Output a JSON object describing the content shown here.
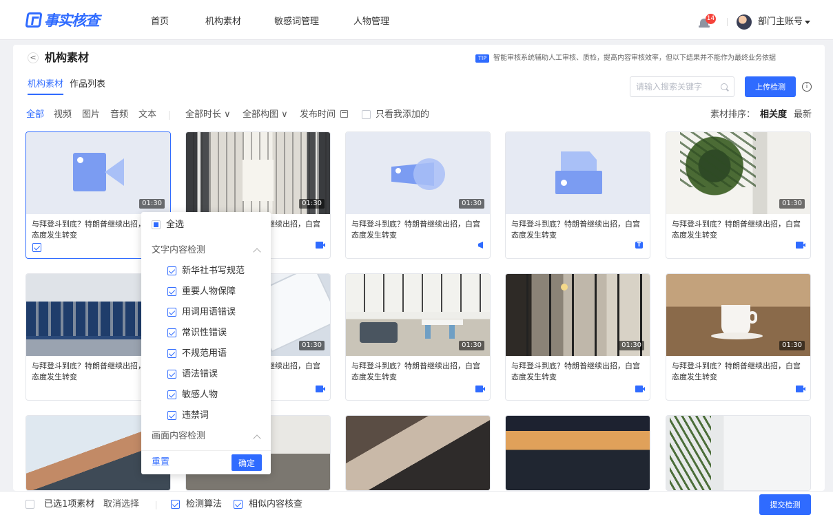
{
  "brand": {
    "logo_text": "事实核查"
  },
  "nav": {
    "items": [
      "首页",
      "机构素材",
      "敏感词管理",
      "人物管理"
    ]
  },
  "user": {
    "notification_count": "14",
    "account_label": "部门主账号"
  },
  "page": {
    "title": "机构素材",
    "tip_badge": "TIP",
    "tip_text": "智能审核系统辅助人工审核、质检，提高内容审核效率，但以下结果并不能作为最终业务依据"
  },
  "tabs": [
    "机构素材",
    "作品列表"
  ],
  "search": {
    "placeholder": "请输入搜索关键字"
  },
  "upload_label": "上传检测",
  "filters": {
    "types": [
      "全部",
      "视频",
      "图片",
      "音频",
      "文本"
    ],
    "duration": "全部时长",
    "composition": "全部构图",
    "publish_time": "发布时间",
    "mine_only": "只看我添加的",
    "sort_label": "素材排序：",
    "sort_options": [
      "相关度",
      "最新"
    ]
  },
  "cards": [
    {
      "title": "与拜登斗到底？特朗普继续出招，白宫态度发生转变",
      "duration": "01:30",
      "type_icon": "checkbox",
      "selected": true
    },
    {
      "title": "与拜登斗到底？特朗普继续出招，白宫态度发生转变",
      "duration": "01:30",
      "type_icon": "video-icon"
    },
    {
      "title": "与拜登斗到底？特朗普继续出招，白宫态度发生转变",
      "duration": "01:30",
      "type_icon": "audio-icon"
    },
    {
      "title": "与拜登斗到底？特朗普继续出招，白宫态度发生转变",
      "duration": "",
      "type_icon": "text-icon"
    },
    {
      "title": "与拜登斗到底？特朗普继续出招，白宫态度发生转变",
      "duration": "01:30",
      "type_icon": "video-icon"
    },
    {
      "title": "与拜登斗到底？特朗普继续出招，白宫态度发生转变",
      "duration": "",
      "type_icon": "video-icon"
    },
    {
      "title": "与拜登斗到底？特朗普继续出招，白宫态度发生转变",
      "duration": "01:30",
      "type_icon": "video-icon"
    },
    {
      "title": "与拜登斗到底？特朗普继续出招，白宫态度发生转变",
      "duration": "01:30",
      "type_icon": "video-icon"
    },
    {
      "title": "与拜登斗到底？特朗普继续出招，白宫态度发生转变",
      "duration": "01:30",
      "type_icon": "video-icon"
    },
    {
      "title": "与拜登斗到底？特朗普继续出招，白宫态度发生转变",
      "duration": "01:30",
      "type_icon": "video-icon"
    }
  ],
  "text_icon_glyph": "T",
  "dropdown": {
    "select_all": "全选",
    "section_text": "文字内容检测",
    "options": [
      "新华社书写规范",
      "重要人物保障",
      "用词用语错误",
      "常识性错误",
      "不规范用语",
      "语法错误",
      "敏感人物",
      "违禁词"
    ],
    "section_image": "画面内容检测",
    "reset": "重置",
    "confirm": "确定"
  },
  "bottom": {
    "selected_count": "已选1项素材",
    "cancel_select": "取消选择",
    "algo": "检测算法",
    "similar": "相似内容核查",
    "submit": "提交检测"
  },
  "colors": {
    "accent": "#2f6bff",
    "badge": "#f5433b"
  }
}
